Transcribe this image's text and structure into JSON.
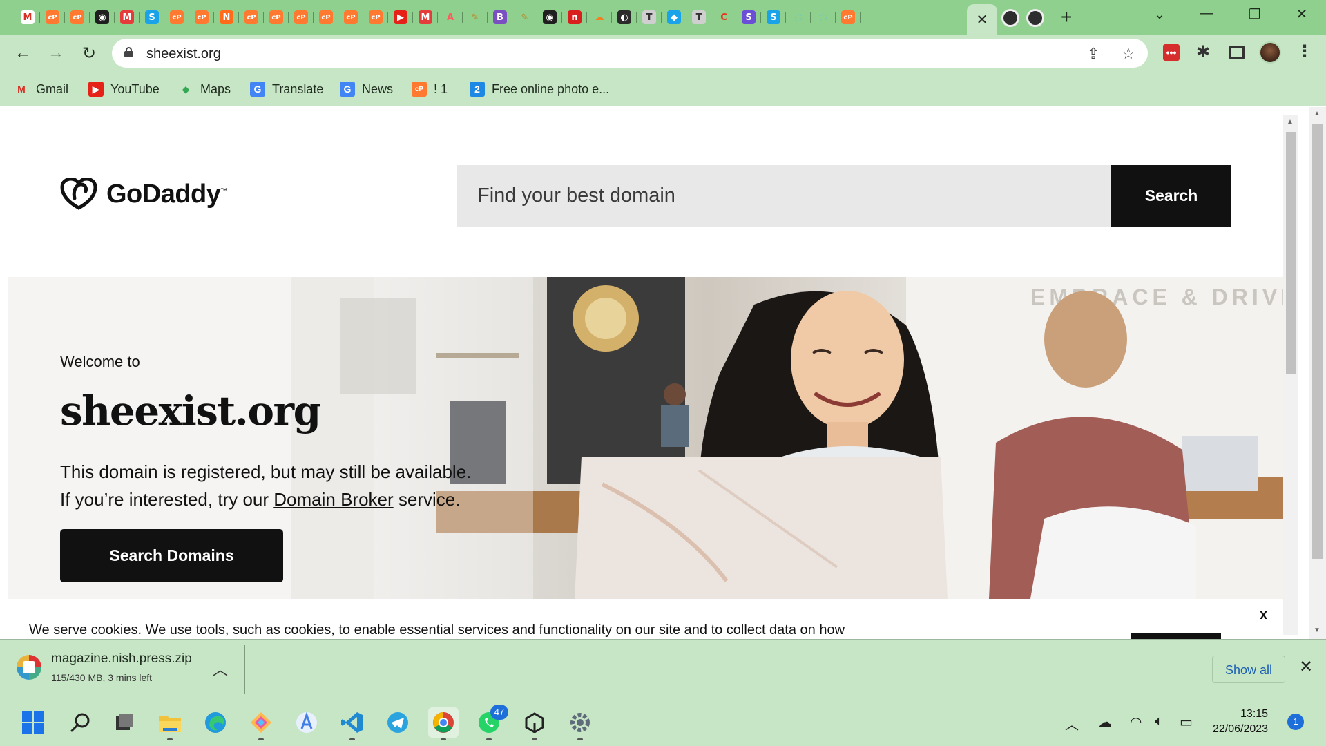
{
  "browser": {
    "tab_favicons": [
      {
        "name": "gmail",
        "color": "#ffffff",
        "text": "M",
        "fg": "#d93025"
      },
      {
        "name": "copilot",
        "color": "#ff7a30",
        "text": "cP",
        "fg": "#ffffff"
      },
      {
        "name": "copilot",
        "color": "#ff7a30",
        "text": "cP",
        "fg": "#ffffff"
      },
      {
        "name": "github",
        "color": "#1f1f1f",
        "text": "◉",
        "fg": "#ffffff"
      },
      {
        "name": "medium",
        "color": "#e63b3b",
        "text": "M",
        "fg": "#ffffff"
      },
      {
        "name": "skype",
        "color": "#1aa3e8",
        "text": "S",
        "fg": "#ffffff"
      },
      {
        "name": "copilot",
        "color": "#ff7a30",
        "text": "cP",
        "fg": "#ffffff"
      },
      {
        "name": "copilot",
        "color": "#ff7a30",
        "text": "cP",
        "fg": "#ffffff"
      },
      {
        "name": "n-app",
        "color": "#ff6b1a",
        "text": "N",
        "fg": "#ffffff"
      },
      {
        "name": "copilot",
        "color": "#ff7a30",
        "text": "cP",
        "fg": "#ffffff"
      },
      {
        "name": "copilot",
        "color": "#ff7a30",
        "text": "cP",
        "fg": "#ffffff"
      },
      {
        "name": "copilot",
        "color": "#ff7a30",
        "text": "cP",
        "fg": "#ffffff"
      },
      {
        "name": "copilot",
        "color": "#ff7a30",
        "text": "cP",
        "fg": "#ffffff"
      },
      {
        "name": "copilot",
        "color": "#ff7a30",
        "text": "cP",
        "fg": "#ffffff"
      },
      {
        "name": "copilot",
        "color": "#ff7a30",
        "text": "cP",
        "fg": "#ffffff"
      },
      {
        "name": "youtube",
        "color": "#e62117",
        "text": "▶",
        "fg": "#ffffff"
      },
      {
        "name": "medium",
        "color": "#e63b3b",
        "text": "M",
        "fg": "#ffffff"
      },
      {
        "name": "airbnb",
        "color": "#8fd08e",
        "text": "A",
        "fg": "#ff5a5f"
      },
      {
        "name": "pencil",
        "color": "#8fd08e",
        "text": "✎",
        "fg": "#b88a2a"
      },
      {
        "name": "bootstrap",
        "color": "#7a4fc1",
        "text": "B",
        "fg": "#ffffff"
      },
      {
        "name": "pencil",
        "color": "#8fd08e",
        "text": "✎",
        "fg": "#b88a2a"
      },
      {
        "name": "github",
        "color": "#1f1f1f",
        "text": "◉",
        "fg": "#ffffff"
      },
      {
        "name": "notion-red",
        "color": "#d91e1e",
        "text": "n",
        "fg": "#ffffff"
      },
      {
        "name": "cloudflare",
        "color": "#8fd08e",
        "text": "☁",
        "fg": "#f38020"
      },
      {
        "name": "globe",
        "color": "#2b2b2b",
        "text": "◐",
        "fg": "#ffffff"
      },
      {
        "name": "xda",
        "color": "#cfcfcf",
        "text": "T",
        "fg": "#333333"
      },
      {
        "name": "maps-pin",
        "color": "#1aa3e8",
        "text": "◆",
        "fg": "#ffffff"
      },
      {
        "name": "xda",
        "color": "#cfcfcf",
        "text": "T",
        "fg": "#333333"
      },
      {
        "name": "c-app",
        "color": "#8fd08e",
        "text": "C",
        "fg": "#e6331a"
      },
      {
        "name": "s-purple",
        "color": "#6a4fd6",
        "text": "S",
        "fg": "#ffffff"
      },
      {
        "name": "skype",
        "color": "#1aa3e8",
        "text": "S",
        "fg": "#ffffff"
      },
      {
        "name": "loading",
        "color": "#8fd08e",
        "text": "◌",
        "fg": "#6fc6c0"
      },
      {
        "name": "loading",
        "color": "#8fd08e",
        "text": "◌",
        "fg": "#6fc6c0"
      },
      {
        "name": "copilot",
        "color": "#ff7a30",
        "text": "cP",
        "fg": "#ffffff"
      }
    ],
    "address": {
      "url": "sheexist.org"
    },
    "bookmarks": [
      {
        "label": "Gmail",
        "icon": "gmail-icon",
        "glyph": "M",
        "fg": "#d93025",
        "bg": "transparent"
      },
      {
        "label": "YouTube",
        "icon": "youtube-icon",
        "glyph": "▶",
        "fg": "#ffffff",
        "bg": "#e62117"
      },
      {
        "label": "Maps",
        "icon": "maps-icon",
        "glyph": "◆",
        "fg": "#34a853",
        "bg": "transparent"
      },
      {
        "label": "Translate",
        "icon": "translate-icon",
        "glyph": "G",
        "fg": "#ffffff",
        "bg": "#4285f4"
      },
      {
        "label": "News",
        "icon": "news-icon",
        "glyph": "G",
        "fg": "#ffffff",
        "bg": "#4285f4"
      },
      {
        "label": "! 1",
        "icon": "copilot-icon",
        "glyph": "cP",
        "fg": "#ffffff",
        "bg": "#ff7a30"
      },
      {
        "label": "Free online photo e...",
        "icon": "photo-editor-icon",
        "glyph": "2",
        "fg": "#ffffff",
        "bg": "#1e88e5"
      }
    ]
  },
  "site": {
    "logo_text": "GoDaddy",
    "logo_tm": "™",
    "search": {
      "placeholder": "Find your best domain",
      "button": "Search"
    },
    "hero": {
      "welcome": "Welcome to",
      "domain": "sheexist.org",
      "line1": "This domain is registered, but may still be available.",
      "line2_pre": "If you’re interested, try our ",
      "line2_link": "Domain Broker",
      "line2_post": " service.",
      "cta": "Search Domains",
      "wall_text": "EMBRACE & DRIVE"
    },
    "cookie": {
      "text": "We serve cookies. We use tools, such as cookies, to enable essential services and functionality on our site and to collect data on how",
      "close": "x"
    }
  },
  "download": {
    "filename": "magazine.nish.press.zip",
    "status": "115/430 MB, 3 mins left",
    "show_all": "Show all"
  },
  "taskbar": {
    "apps": [
      "windows-start",
      "search",
      "task-view",
      "file-explorer",
      "edge",
      "git-tool",
      "android-studio",
      "vscode",
      "telegram",
      "chrome",
      "whatsapp",
      "unity",
      "settings"
    ],
    "whatsapp_badge": "47",
    "clock_time": "13:15",
    "clock_date": "22/06/2023",
    "notifications": "1"
  }
}
